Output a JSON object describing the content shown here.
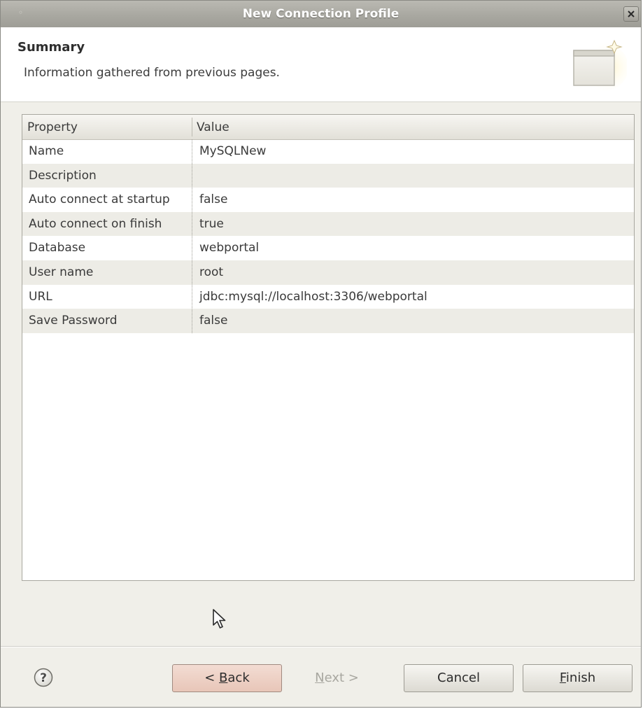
{
  "window": {
    "title": "New Connection Profile"
  },
  "banner": {
    "title": "Summary",
    "description": "Information gathered from previous pages."
  },
  "table": {
    "columns": [
      "Property",
      "Value"
    ],
    "rows": [
      {
        "property": "Name",
        "value": "MySQLNew"
      },
      {
        "property": "Description",
        "value": ""
      },
      {
        "property": "Auto connect at startup",
        "value": "false"
      },
      {
        "property": "Auto connect on finish",
        "value": "true"
      },
      {
        "property": "Database",
        "value": "webportal"
      },
      {
        "property": "User name",
        "value": "root"
      },
      {
        "property": "URL",
        "value": "jdbc:mysql://localhost:3306/webportal"
      },
      {
        "property": "Save Password",
        "value": "false"
      }
    ]
  },
  "buttons": {
    "back_prefix": "< ",
    "back_mnemonic": "B",
    "back_rest": "ack",
    "next_mnemonic": "N",
    "next_rest": "ext >",
    "cancel": "Cancel",
    "finish_mnemonic": "F",
    "finish_rest": "inish"
  },
  "icons": {
    "help": "help-icon",
    "close": "close-icon",
    "wizard": "wizard-banner-icon",
    "cursor": "mouse-pointer-icon"
  }
}
